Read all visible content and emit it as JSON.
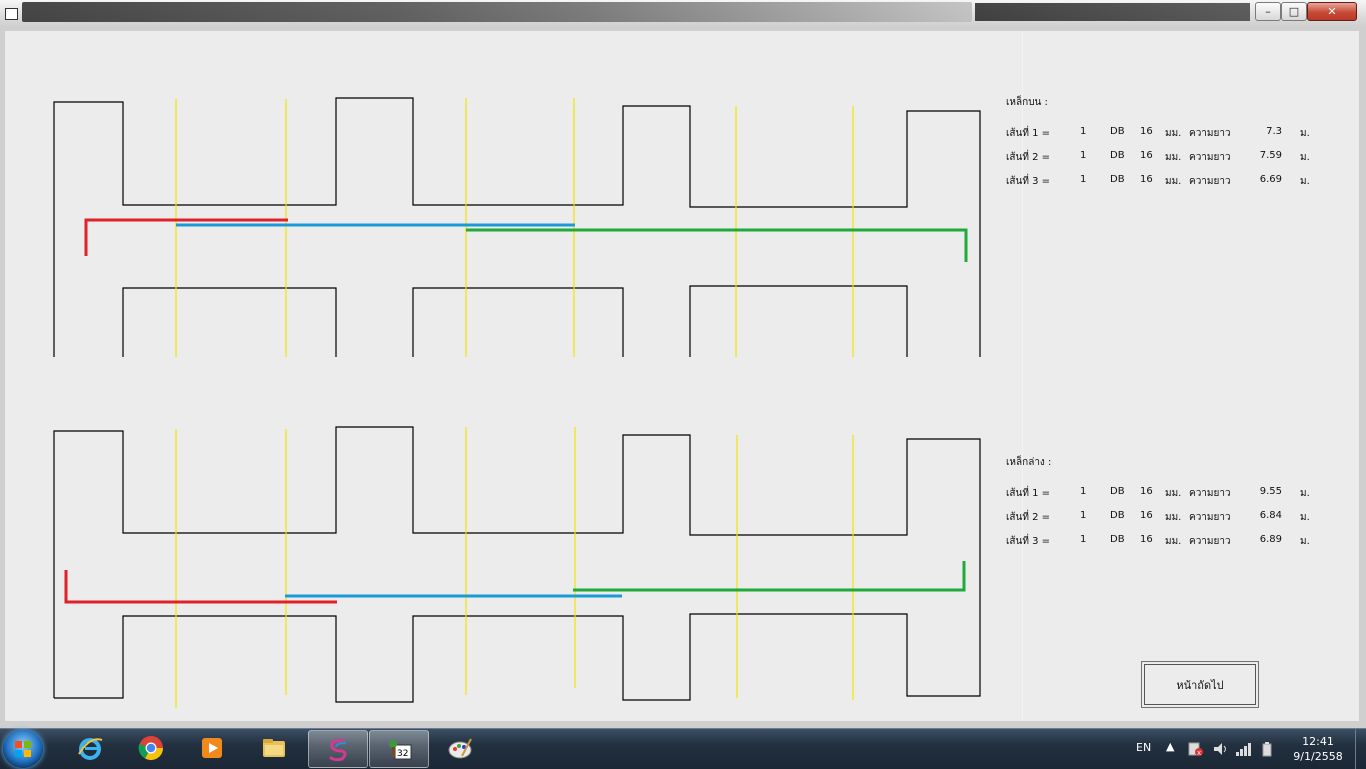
{
  "upper_section": {
    "heading": "เหล็กบน  :",
    "rows": [
      {
        "name": "เส้นที่ 1 =",
        "count": "1",
        "type": "DB",
        "diameter": "16",
        "unit_mm": "มม.",
        "length_label": "ความยาว",
        "length": "7.3",
        "unit_m": "ม."
      },
      {
        "name": "เส้นที่ 2 =",
        "count": "1",
        "type": "DB",
        "diameter": "16",
        "unit_mm": "มม.",
        "length_label": "ความยาว",
        "length": "7.59",
        "unit_m": "ม."
      },
      {
        "name": "เส้นที่ 3 =",
        "count": "1",
        "type": "DB",
        "diameter": "16",
        "unit_mm": "มม.",
        "length_label": "ความยาว",
        "length": "6.69",
        "unit_m": "ม."
      }
    ]
  },
  "lower_section": {
    "heading": "เหล็กล่าง  :",
    "rows": [
      {
        "name": "เส้นที่ 1 =",
        "count": "1",
        "type": "DB",
        "diameter": "16",
        "unit_mm": "มม.",
        "length_label": "ความยาว",
        "length": "9.55",
        "unit_m": "ม."
      },
      {
        "name": "เส้นที่ 2 =",
        "count": "1",
        "type": "DB",
        "diameter": "16",
        "unit_mm": "มม.",
        "length_label": "ความยาว",
        "length": "6.84",
        "unit_m": "ม."
      },
      {
        "name": "เส้นที่ 3 =",
        "count": "1",
        "type": "DB",
        "diameter": "16",
        "unit_mm": "มม.",
        "length_label": "ความยาว",
        "length": "6.89",
        "unit_m": "ม."
      }
    ]
  },
  "next_button": {
    "label": "หน้าถัดไป"
  },
  "window_controls": {
    "minimize": "–",
    "maximize": "□",
    "close": "✕"
  },
  "taskbar": {
    "apps": [
      {
        "icon": "internet-explorer-icon"
      },
      {
        "icon": "chrome-icon"
      },
      {
        "icon": "media-player-icon"
      },
      {
        "icon": "file-explorer-icon"
      },
      {
        "icon": "app-s-icon"
      },
      {
        "icon": "app-32-icon"
      },
      {
        "icon": "paint-icon"
      }
    ],
    "language": "EN",
    "time": "12:41",
    "date": "9/1/2558"
  },
  "colors": {
    "bar_1": "#e0202a",
    "bar_2": "#1a9ad6",
    "bar_3": "#1faa3a",
    "grid_line": "#f2e400",
    "outline": "#000000"
  }
}
